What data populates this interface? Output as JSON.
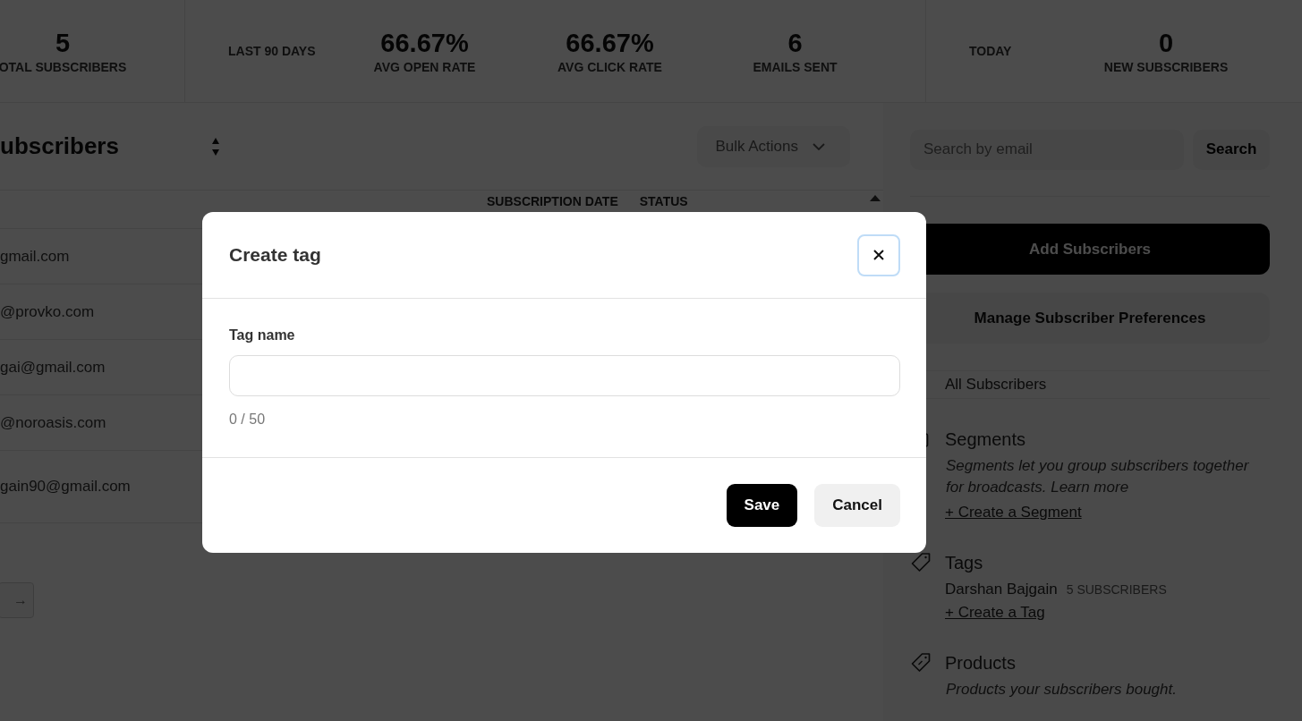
{
  "stats_bar": {
    "groups": [
      {
        "stats": [
          {
            "value": "5",
            "label": "OTAL SUBSCRIBERS"
          }
        ]
      },
      {
        "label": "LAST 90 DAYS",
        "stats": [
          {
            "value": "66.67%",
            "label": "AVG OPEN RATE"
          },
          {
            "value": "66.67%",
            "label": "AVG CLICK RATE"
          },
          {
            "value": "6",
            "label": "EMAILS SENT"
          }
        ]
      },
      {
        "label": "TODAY",
        "stats": [
          {
            "value": "0",
            "label": "NEW SUBSCRIBERS"
          }
        ]
      }
    ]
  },
  "subscribers": {
    "title": "ubscribers",
    "bulk_actions": "Bulk Actions",
    "columns": [
      "SUBSCRIPTION DATE",
      "STATUS"
    ],
    "rows": [
      "gmail.com",
      "@provko.com",
      "gai@gmail.com",
      "@noroasis.com",
      "gain90@gmail.com"
    ],
    "pagination": "→"
  },
  "sidebar": {
    "search": {
      "placeholder": "Search by email",
      "button": "Search"
    },
    "add_button": "Add Subscribers",
    "preferences_button": "Manage Subscriber Preferences",
    "all_subscribers": "All Subscribers",
    "sections": [
      {
        "kind": "segments",
        "title": "Segments",
        "description": "Segments let you group subscribers together for broadcasts.",
        "link": "Learn more",
        "create": "+ Create a Segment"
      },
      {
        "kind": "tags",
        "title": "Tags",
        "items": [
          {
            "name": "Darshan Bajgain",
            "count": "5 SUBSCRIBERS"
          }
        ],
        "create": "+ Create a Tag"
      },
      {
        "kind": "products",
        "title": "Products",
        "description": "Products your subscribers bought."
      }
    ]
  },
  "modal": {
    "title": "Create tag",
    "field_label": "Tag name",
    "counter": "0 / 50",
    "buttons": [
      {
        "label": "Save",
        "kind": "primary"
      },
      {
        "label": "Cancel",
        "kind": "secondary"
      }
    ]
  }
}
